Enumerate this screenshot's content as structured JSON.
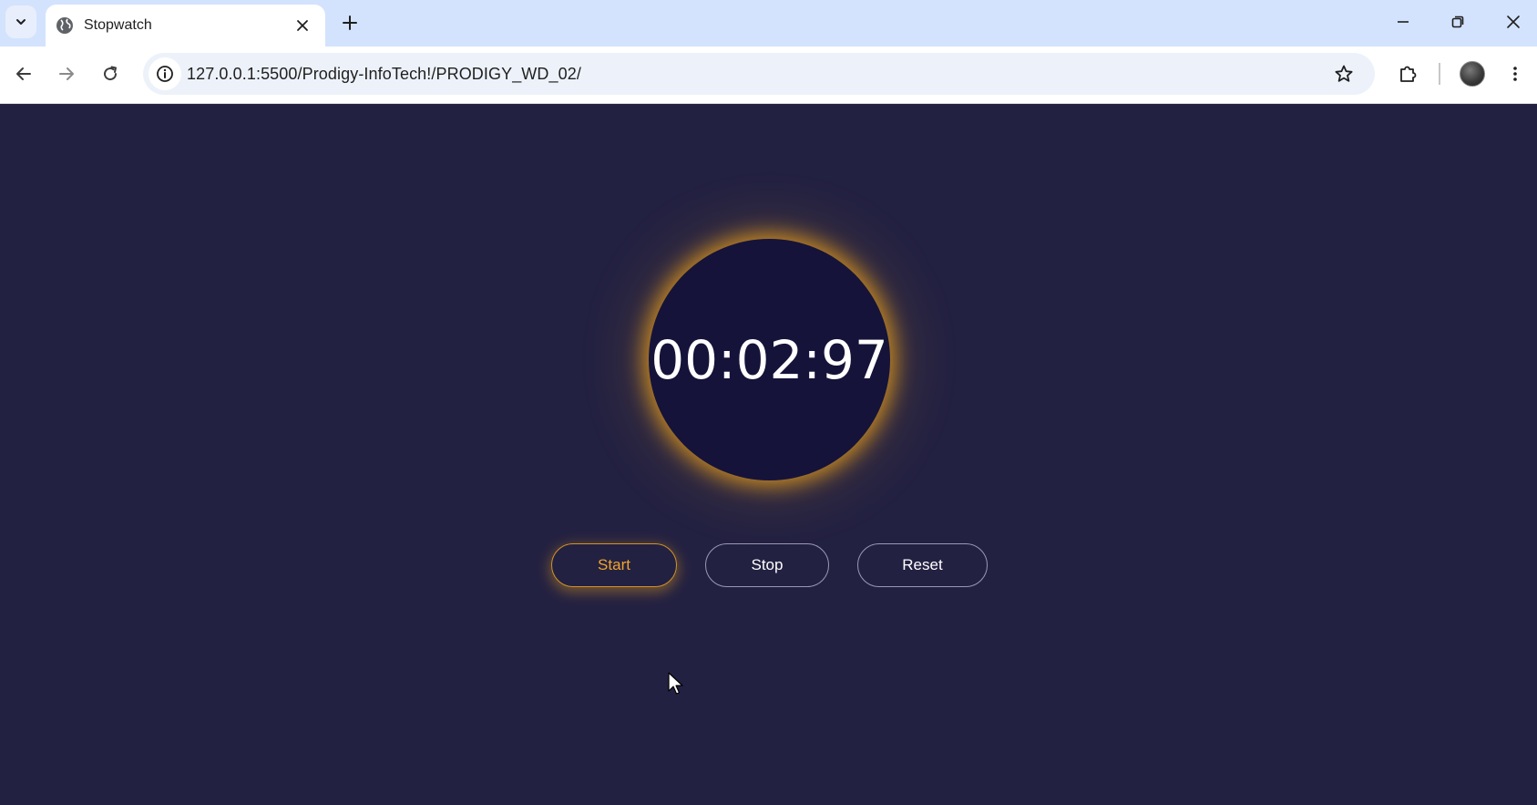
{
  "browser": {
    "tab": {
      "title": "Stopwatch"
    },
    "address_bar": {
      "url": "127.0.0.1:5500/Prodigy-InfoTech!/PRODIGY_WD_02/"
    }
  },
  "stopwatch": {
    "time_display": "00:02:97",
    "buttons": {
      "start": "Start",
      "stop": "Stop",
      "reset": "Reset"
    }
  },
  "theme": {
    "page_background": "#232142",
    "clock_face": "#15133a",
    "accent_glow": "#d8941e",
    "start_text": "#f0a42b",
    "browser_tabstrip": "#d3e3fd"
  },
  "icons": {
    "tab_search": "chevron-down-icon",
    "favicon": "globe-icon",
    "tab_close": "close-icon",
    "new_tab": "plus-icon",
    "back": "arrow-left-icon",
    "forward": "arrow-right-icon",
    "reload": "reload-icon",
    "site_info": "info-icon",
    "bookmark": "star-icon",
    "extensions": "puzzle-icon",
    "profile": "avatar-icon",
    "menu": "kebab-menu-icon"
  }
}
